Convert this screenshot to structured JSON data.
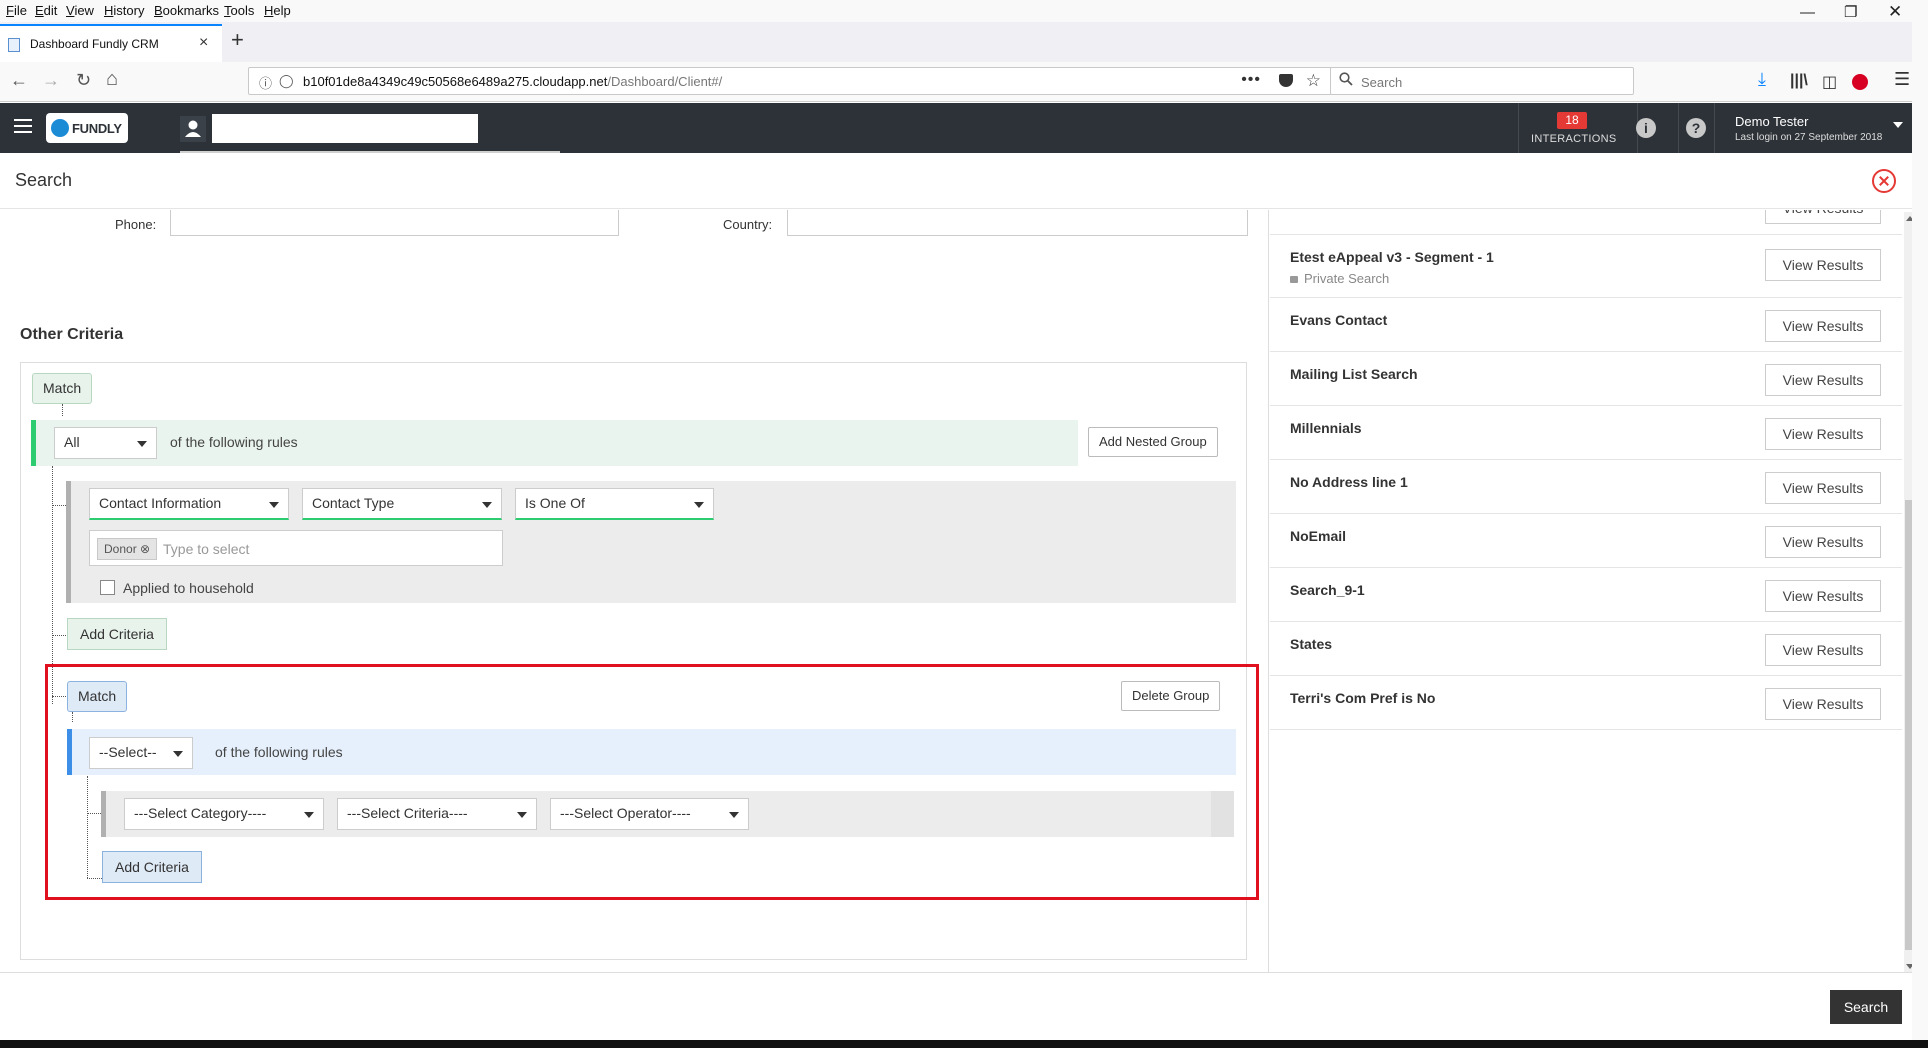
{
  "browser": {
    "menu": [
      "File",
      "Edit",
      "View",
      "History",
      "Bookmarks",
      "Tools",
      "Help"
    ],
    "tab_title": "Dashboard Fundly CRM",
    "url_main": "b10f01de8a4349c49c50568e6489a275.cloudapp.net",
    "url_path": "/Dashboard/Client#/",
    "search_placeholder": "Search",
    "colors": {
      "accent": "#0a84ff"
    }
  },
  "app": {
    "logo_text": "FUNDLY",
    "interactions_count": "18",
    "interactions_label": "INTERACTIONS",
    "info_icon": "i",
    "help_icon": "?",
    "user_name": "Demo Tester",
    "last_login": "Last login on 27 September 2018",
    "colors": {
      "header_bg": "#2d3238",
      "badge": "#e53935"
    }
  },
  "panel": {
    "title": "Search"
  },
  "form": {
    "phone_label": "Phone:",
    "country_label": "Country:",
    "other_criteria_title": "Other Criteria",
    "group1": {
      "match_label": "Match",
      "match_value": "All",
      "rules_text": "of the following rules",
      "add_nested_group": "Add Nested Group",
      "criteria": {
        "category": "Contact Information",
        "field": "Contact Type",
        "operator": "Is One Of",
        "tag": "Donor",
        "tag_placeholder": "Type to select",
        "household_label": "Applied to household",
        "household_checked": false
      },
      "add_criteria": "Add Criteria"
    },
    "group2": {
      "match_label": "Match",
      "delete_group": "Delete Group",
      "match_value": "--Select--",
      "rules_text": "of the following rules",
      "category_placeholder": "---Select Category----",
      "criteria_placeholder": "---Select Criteria----",
      "operator_placeholder": "---Select Operator----",
      "add_criteria": "Add Criteria",
      "highlight_color": "#e0101e"
    }
  },
  "saved_searches": {
    "partial_top_button": "View Results",
    "items": [
      {
        "name": "Etest eAppeal v3 - Segment - 1",
        "private": "Private Search",
        "button": "View Results"
      },
      {
        "name": "Evans Contact",
        "button": "View Results"
      },
      {
        "name": "Mailing List Search",
        "button": "View Results"
      },
      {
        "name": "Millennials",
        "button": "View Results"
      },
      {
        "name": "No Address line 1",
        "button": "View Results"
      },
      {
        "name": "NoEmail",
        "button": "View Results"
      },
      {
        "name": "Search_9-1",
        "button": "View Results"
      },
      {
        "name": "States",
        "button": "View Results"
      },
      {
        "name": "Terri's Com Pref is No",
        "button": "View Results"
      }
    ]
  },
  "footer": {
    "search_button": "Search"
  }
}
